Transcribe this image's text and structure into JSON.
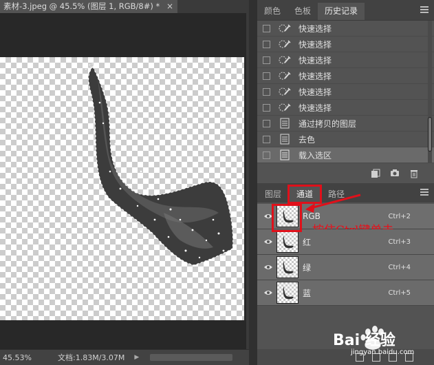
{
  "document": {
    "tab_title": "素材-3.jpeg @ 45.5% (图层 1, RGB/8#) *",
    "close_glyph": "×"
  },
  "status_bar": {
    "zoom": "45.53%",
    "doc_info": "文档:1.83M/3.07M",
    "arrow": "▶"
  },
  "history_panel": {
    "tabs": [
      "颜色",
      "色板",
      "历史记录"
    ],
    "active_tab": "历史记录",
    "items": [
      {
        "label": "快速选择",
        "icon": "quick-select-icon"
      },
      {
        "label": "快速选择",
        "icon": "quick-select-icon"
      },
      {
        "label": "快速选择",
        "icon": "quick-select-icon"
      },
      {
        "label": "快速选择",
        "icon": "quick-select-icon"
      },
      {
        "label": "快速选择",
        "icon": "quick-select-icon"
      },
      {
        "label": "快速选择",
        "icon": "quick-select-icon"
      },
      {
        "label": "通过拷贝的图层",
        "icon": "history-doc-icon"
      },
      {
        "label": "去色",
        "icon": "history-doc-icon"
      },
      {
        "label": "载入选区",
        "icon": "history-doc-icon"
      }
    ],
    "selected_index": 8
  },
  "channels_panel": {
    "tabs": [
      "图层",
      "通道",
      "路径"
    ],
    "active_tab": "通道",
    "channels": [
      {
        "name": "RGB",
        "shortcut": "Ctrl+2"
      },
      {
        "name": "红",
        "shortcut": "Ctrl+3"
      },
      {
        "name": "绿",
        "shortcut": "Ctrl+4"
      },
      {
        "name": "蓝",
        "shortcut": "Ctrl+5"
      }
    ],
    "annotation": "按住Ctrl键单击"
  },
  "watermark": {
    "brand": "Bai 经验",
    "url": "jingyan.baidu.com"
  },
  "colors": {
    "accent_red": "#e0101a",
    "panel_bg": "#535353",
    "canvas_dark": "#282828"
  }
}
